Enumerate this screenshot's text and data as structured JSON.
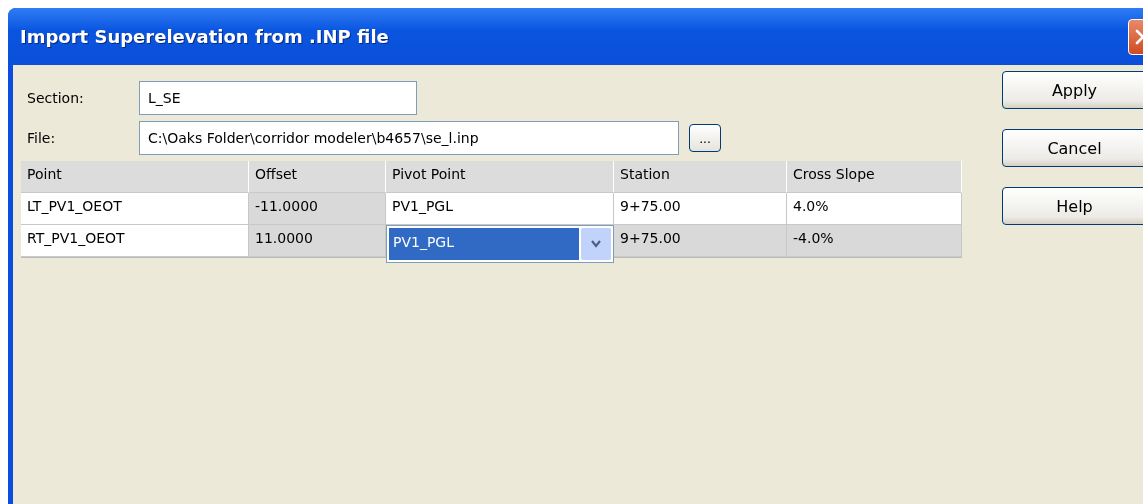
{
  "window": {
    "title": "Import Superelevation from .INP file"
  },
  "fields": [
    {
      "label": "Section:",
      "value": "L_SE",
      "browse": false
    },
    {
      "label": "File:",
      "value": "C:\\Oaks Folder\\corridor modeler\\b4657\\se_l.inp",
      "browse": true,
      "browse_label": "..."
    }
  ],
  "table": {
    "columns": [
      "Point",
      "Offset",
      "Pivot Point",
      "Station",
      "Cross Slope"
    ],
    "rows": [
      {
        "cells": [
          "LT_PV1_OEOT",
          "-11.0000",
          "PV1_PGL",
          "9+75.00",
          "4.0%"
        ],
        "editing": false
      },
      {
        "cells": [
          "RT_PV1_OEOT",
          "11.0000",
          "PV1_PGL",
          "9+75.00",
          "-4.0%"
        ],
        "editing": true
      }
    ]
  },
  "buttons": [
    "Apply",
    "Cancel",
    "Help"
  ]
}
